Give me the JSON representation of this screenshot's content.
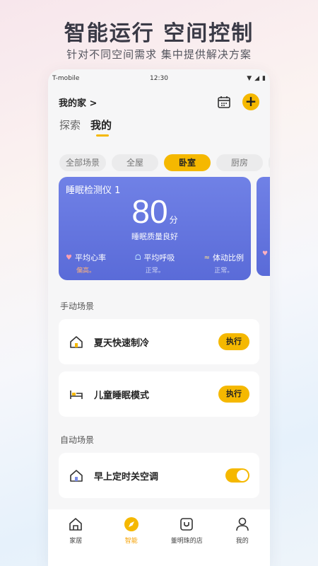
{
  "hero": {
    "title": "智能运行 空间控制",
    "subtitle": "针对不同空间需求  集中提供解决方案"
  },
  "statusbar": {
    "carrier": "T-mobile",
    "time": "12:30"
  },
  "header": {
    "home_title": "我的家 >",
    "calendar_icon": "calendar-icon",
    "add_label": "+"
  },
  "tabs": [
    {
      "label": "探索",
      "active": false
    },
    {
      "label": "我的",
      "active": true
    }
  ],
  "filters": [
    {
      "label": "全部场景",
      "active": false
    },
    {
      "label": "全屋",
      "active": false
    },
    {
      "label": "卧室",
      "active": true
    },
    {
      "label": "厨房",
      "active": false
    }
  ],
  "sleep_card": {
    "device": "睡眠检测仪 1",
    "score": "80",
    "unit": "分",
    "quality": "睡眠质量良好",
    "metrics": [
      {
        "icon": "heart-icon",
        "label": "平均心率",
        "value": "偏高。"
      },
      {
        "icon": "lungs-icon",
        "label": "平均呼吸",
        "value": "正常。"
      },
      {
        "icon": "motion-icon",
        "label": "体动比例",
        "value": "正常。"
      }
    ]
  },
  "manual": {
    "label": "手动场景",
    "scenes": [
      {
        "name": "夏天快速制冷",
        "icon": "house-icon",
        "action": "执行"
      },
      {
        "name": "儿童睡眠模式",
        "icon": "bed-icon",
        "action": "执行"
      }
    ]
  },
  "auto": {
    "label": "自动场景",
    "scenes": [
      {
        "name": "早上定时关空调",
        "icon": "house-icon",
        "enabled": true
      }
    ]
  },
  "nav": [
    {
      "label": "家居",
      "icon": "home-icon",
      "active": false
    },
    {
      "label": "智能",
      "icon": "compass-icon",
      "active": true
    },
    {
      "label": "董明珠的店",
      "icon": "shop-icon",
      "active": false
    },
    {
      "label": "我的",
      "icon": "user-icon",
      "active": false
    }
  ],
  "colors": {
    "accent": "#f5b800",
    "card": "#6676e0"
  }
}
